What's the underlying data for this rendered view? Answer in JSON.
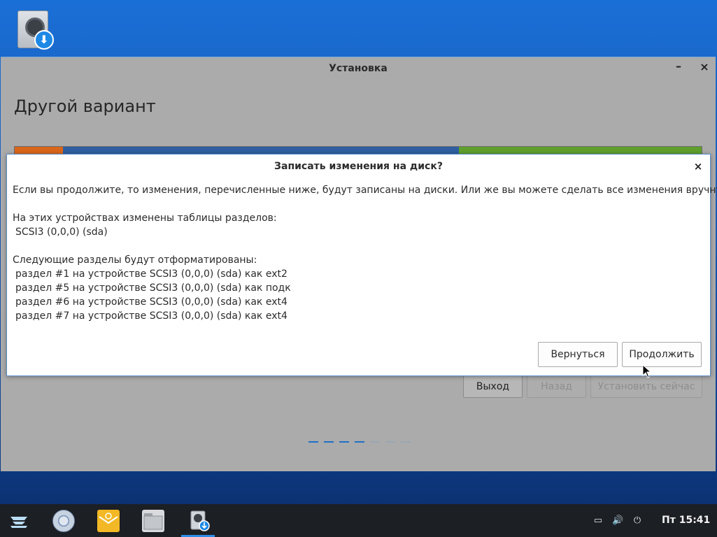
{
  "window": {
    "title": "Установка",
    "minimize": "–",
    "close": "×"
  },
  "page": {
    "heading": "Другой вариант"
  },
  "partition_bar": {
    "segments": [
      {
        "color": "#d9661a",
        "fraction": 0.07
      },
      {
        "color": "#2f5fa0",
        "fraction": 0.577
      },
      {
        "color": "#5f9f2c",
        "fraction": 0.353
      }
    ]
  },
  "background_buttons": {
    "quit": "Выход",
    "back": "Назад",
    "install_now": "Установить сейчас"
  },
  "progress_dots": {
    "total": 7,
    "active": 4
  },
  "dialog": {
    "title": "Записать изменения на диск?",
    "close": "×",
    "intro": "Если вы продолжите, то изменения, перечисленные ниже, будут записаны на диски. Или же вы можете сделать все изменения вручную.",
    "tables_heading": "На этих устройствах изменены таблицы разделов:",
    "device": "SCSI3 (0,0,0) (sda)",
    "format_heading": "Следующие разделы будут отформатированы:",
    "partitions": [
      "раздел #1 на устройстве SCSI3 (0,0,0) (sda) как ext2",
      "раздел #5 на устройстве SCSI3 (0,0,0) (sda) как подк",
      "раздел #6 на устройстве SCSI3 (0,0,0) (sda) как ext4",
      "раздел #7 на устройстве SCSI3 (0,0,0) (sda) как ext4"
    ],
    "go_back": "Вернуться",
    "continue": "Продолжить"
  },
  "taskbar": {
    "clock": "Пт 15:41",
    "apps": [
      "zorin-menu-icon",
      "browser-icon",
      "mail-icon",
      "files-icon",
      "installer-icon"
    ]
  },
  "colors": {
    "accent": "#1e88e5",
    "taskbar": "#1c1f24",
    "dialog_border": "#5b8fc9"
  }
}
